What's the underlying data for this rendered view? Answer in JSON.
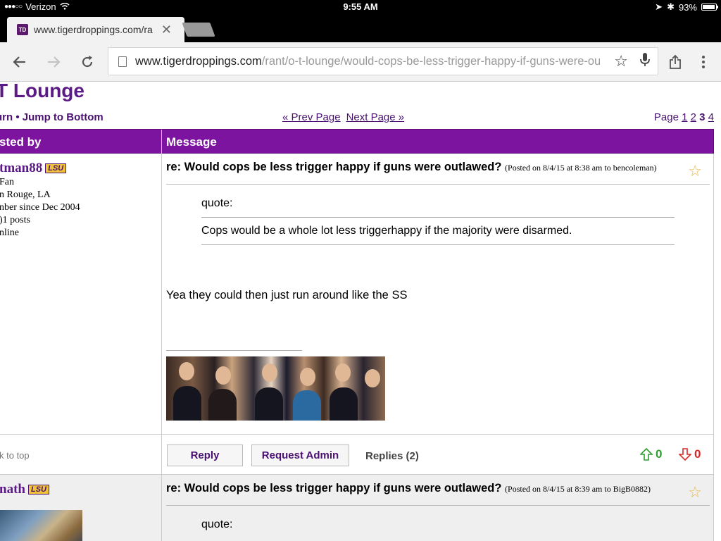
{
  "status_bar": {
    "carrier": "Verizon",
    "time": "9:55 AM",
    "battery": "93%"
  },
  "browser": {
    "tab_title": "www.tigerdroppings.com/ra",
    "favicon_text": "TD",
    "url_host": "www.tigerdroppings.com",
    "url_path": "/rant/o-t-lounge/would-cops-be-less-trigger-happy-if-guns-were-outla"
  },
  "forum": {
    "title": "T Lounge",
    "nav_left": "urn  •  Jump to Bottom",
    "prev_page": "« Prev Page",
    "next_page": "Next Page »",
    "page_label": "Page",
    "pages": [
      "1",
      "2",
      "3",
      "4"
    ],
    "current_page": "3"
  },
  "table": {
    "col_posted_by": "sted by",
    "col_message": "Message"
  },
  "post1": {
    "author": "tman88",
    "badge": "LSU",
    "info": [
      "Fan",
      "n Rouge, LA",
      "nber since Dec 2004",
      ")1 posts",
      "nline"
    ],
    "title": "re: Would cops be less trigger happy if guns were outlawed?",
    "meta": "(Posted on 8/4/15 at 8:38 am to bencoleman)",
    "quote_label": "quote:",
    "quote_text": "Cops would be a whole lot less triggerhappy if the majority were disarmed.",
    "body": "Yea they could then just run around like the SS",
    "back_to_top": "k to top",
    "reply_button": "Reply",
    "request_admin_button": "Request Admin",
    "replies": "Replies (2)",
    "upvotes": "0",
    "downvotes": "0"
  },
  "post2": {
    "author": "nath",
    "badge": "LSU",
    "title": "re: Would cops be less trigger happy if guns were outlawed?",
    "meta": "(Posted on 8/4/15 at 8:39 am to BigB0882)",
    "quote_label": "quote:"
  },
  "colors": {
    "purple_header": "#7d14a0",
    "link_purple": "#4a1170",
    "upvote_green": "#2e9e2e",
    "downvote_red": "#d62828"
  }
}
